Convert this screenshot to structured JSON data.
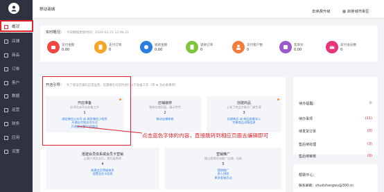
{
  "sidebar": {
    "items": [
      {
        "label": "概况",
        "icon": "dashboard-icon"
      },
      {
        "label": "店铺",
        "icon": "store-icon"
      },
      {
        "label": "商品",
        "icon": "goods-icon"
      },
      {
        "label": "订单",
        "icon": "order-icon"
      },
      {
        "label": "客户",
        "icon": "customer-icon"
      },
      {
        "label": "数据",
        "icon": "data-icon"
      },
      {
        "label": "运营",
        "icon": "operation-icon"
      },
      {
        "label": "财务",
        "icon": "finance-icon"
      },
      {
        "label": "应用",
        "icon": "app-icon"
      },
      {
        "label": "设置",
        "icon": "settings-icon"
      }
    ]
  },
  "topbar": {
    "title": "移动商城",
    "upgrade": "去续费升级",
    "user": "启芽城市街区"
  },
  "overview": {
    "title": "实时概况：",
    "time": "今日数据更新时间：2020-02-21 12:04:21",
    "stats": [
      {
        "label": "支付金额",
        "value": "0.00",
        "color": "#f0483e"
      },
      {
        "label": "支付订单",
        "value": "0",
        "color": "#f5a623"
      },
      {
        "label": "退款金额",
        "value": "0.00",
        "color": "#2a7de1"
      },
      {
        "label": "退款订单",
        "value": "0",
        "color": "#7ec53a"
      },
      {
        "label": "支付客户数",
        "value": "0",
        "color": "#f47c3c"
      },
      {
        "label": "客单价",
        "value": "0.00",
        "color": "#9b59d0"
      },
      {
        "label": "支付会员数",
        "value": "0",
        "color": "#e8327a"
      }
    ]
  },
  "guide": {
    "title": "开店引导：",
    "subtitle": "为了保证店铺的正常运营，您需要在开店时进行以下准备工作（带 ★ 为必备事项）",
    "steps": [
      {
        "head": "开店准备",
        "desc": "必须完成开店准备工作",
        "num": "1",
        "links": [
          "绑定微信公众号 或 绑定微信小程序",
          "开通支付和支付方式",
          "开通或设置10项商品"
        ]
      },
      {
        "head": "店铺装修",
        "desc": "装修店铺页面，展示特色",
        "num": "2",
        "links": [
          "移动店铺装修"
        ]
      },
      {
        "head": "创建商品",
        "desc": "上架了商品才能开门做生意",
        "num": "3",
        "links": [
          "创建商品 或 商品批量导入",
          "完善商品详情信息"
        ]
      },
      {
        "head": "搭建会员体系或会员卡营销",
        "desc": "让客户成为会员，提升复购率",
        "num": "4",
        "links": [
          "新建会员等级体系",
          "设置会员卡信息"
        ]
      },
      {
        "head": "营销推广",
        "desc": "通过营销活动推广店铺，拉新",
        "num": "5",
        "links": [
          "营销推广",
          "多人拼团",
          "更多营销活动"
        ]
      }
    ]
  },
  "hint": "点击蓝色字体的内容，直接跳转到相应页面去编辑即可",
  "todo": {
    "title": "待办提醒：",
    "rows": [
      {
        "label": "待办事项",
        "count": "(11)"
      },
      {
        "label": "待发货订单",
        "count": "(0)"
      },
      {
        "label": "售后待处理",
        "count": "(3)"
      },
      {
        "label": "售后待审核",
        "count": "(0)"
      }
    ]
  },
  "help": {
    "title": "帮助中心：",
    "email": "联系邮箱：shuzishangwu@300.cn"
  }
}
